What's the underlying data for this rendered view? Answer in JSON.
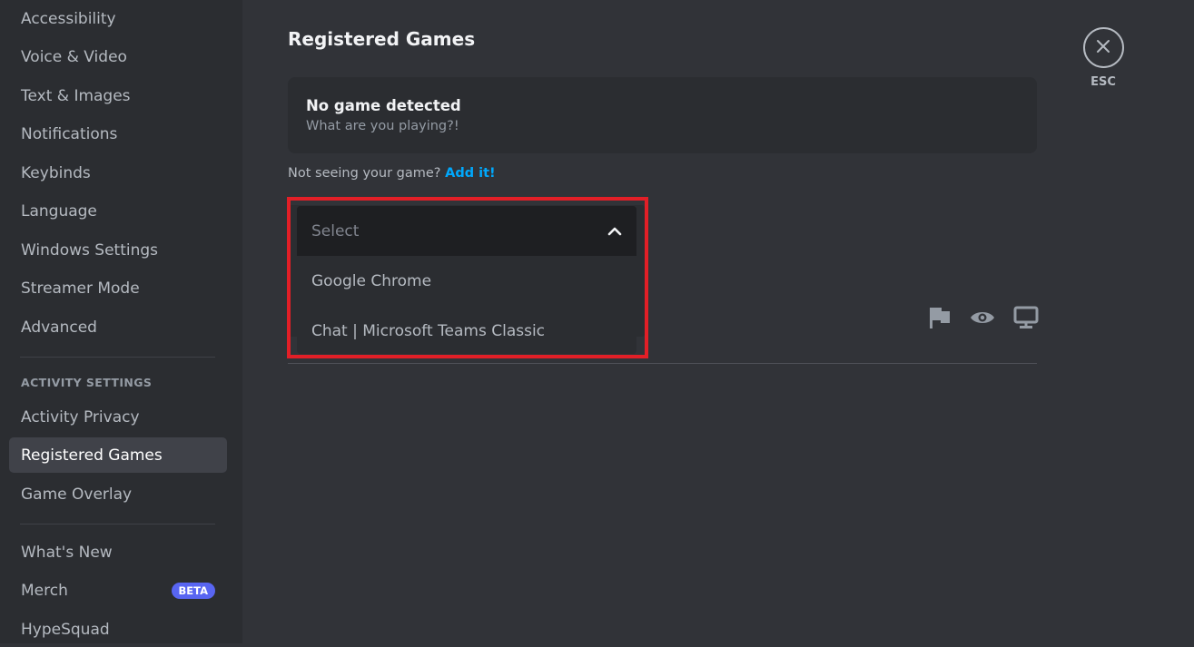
{
  "sidebar": {
    "items_top": [
      {
        "label": "Accessibility"
      },
      {
        "label": "Voice & Video"
      },
      {
        "label": "Text & Images"
      },
      {
        "label": "Notifications"
      },
      {
        "label": "Keybinds"
      },
      {
        "label": "Language"
      },
      {
        "label": "Windows Settings"
      },
      {
        "label": "Streamer Mode"
      },
      {
        "label": "Advanced"
      }
    ],
    "activity_header": "ACTIVITY SETTINGS",
    "activity_items": [
      {
        "label": "Activity Privacy"
      },
      {
        "label": "Registered Games",
        "active": true
      },
      {
        "label": "Game Overlay"
      }
    ],
    "bottom_items": [
      {
        "label": "What's New"
      },
      {
        "label": "Merch",
        "badge": "BETA"
      },
      {
        "label": "HypeSquad"
      }
    ]
  },
  "main": {
    "title": "Registered Games",
    "detect_card": {
      "title": "No game detected",
      "subtitle": "What are you playing?!"
    },
    "not_seeing_text": "Not seeing your game?",
    "add_link": "Add it!",
    "dropdown": {
      "placeholder": "Select",
      "expanded": true,
      "options": [
        "Google Chrome",
        "Chat | Microsoft Teams Classic"
      ]
    },
    "row_icons": [
      "flag-icon",
      "eye-icon",
      "monitor-icon"
    ]
  },
  "close": {
    "label": "ESC"
  },
  "colors": {
    "highlight": "#e21f27",
    "link": "#00a8fc",
    "badge": "#5865f2"
  }
}
